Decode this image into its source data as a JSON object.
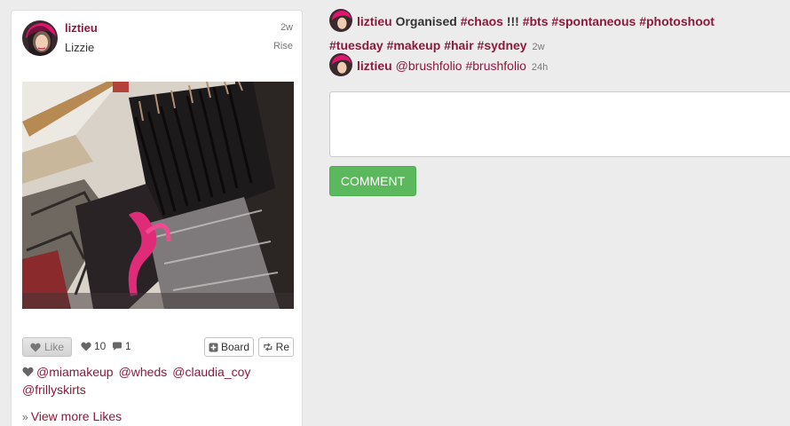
{
  "post": {
    "username": "liztieu",
    "full_name": "Lizzie",
    "age": "2w",
    "brand": "Rise",
    "like_label": "Like",
    "like_count": "10",
    "comment_count": "1",
    "board_label": "Board",
    "repost_label": "Re",
    "likers": [
      "@miamakeup",
      "@wheds",
      "@claudia_coy",
      "@frillyskirts"
    ],
    "view_more_likes": "View more Likes"
  },
  "comments": [
    {
      "username": "liztieu",
      "text_parts": [
        "Organised ",
        "#chaos",
        " !!! ",
        "#bts",
        " ",
        "#spontaneous",
        " ",
        "#photoshoot",
        " ",
        "#tuesday",
        " ",
        "#makeup",
        " ",
        "#hair",
        " ",
        "#sydney"
      ],
      "time": "2w"
    },
    {
      "username": "liztieu",
      "text": "@brushfolio #brushfolio",
      "time": "24h"
    }
  ],
  "comment_form": {
    "placeholder": "",
    "submit_label": "COMMENT"
  },
  "colors": {
    "link": "#8b1a3d",
    "button_green": "#5cb85c",
    "background": "#ececec"
  },
  "icons": {
    "like": "heart-icon",
    "comment": "speech-bubble-icon",
    "board": "plus-square-icon",
    "repost": "repost-arrows-icon"
  }
}
